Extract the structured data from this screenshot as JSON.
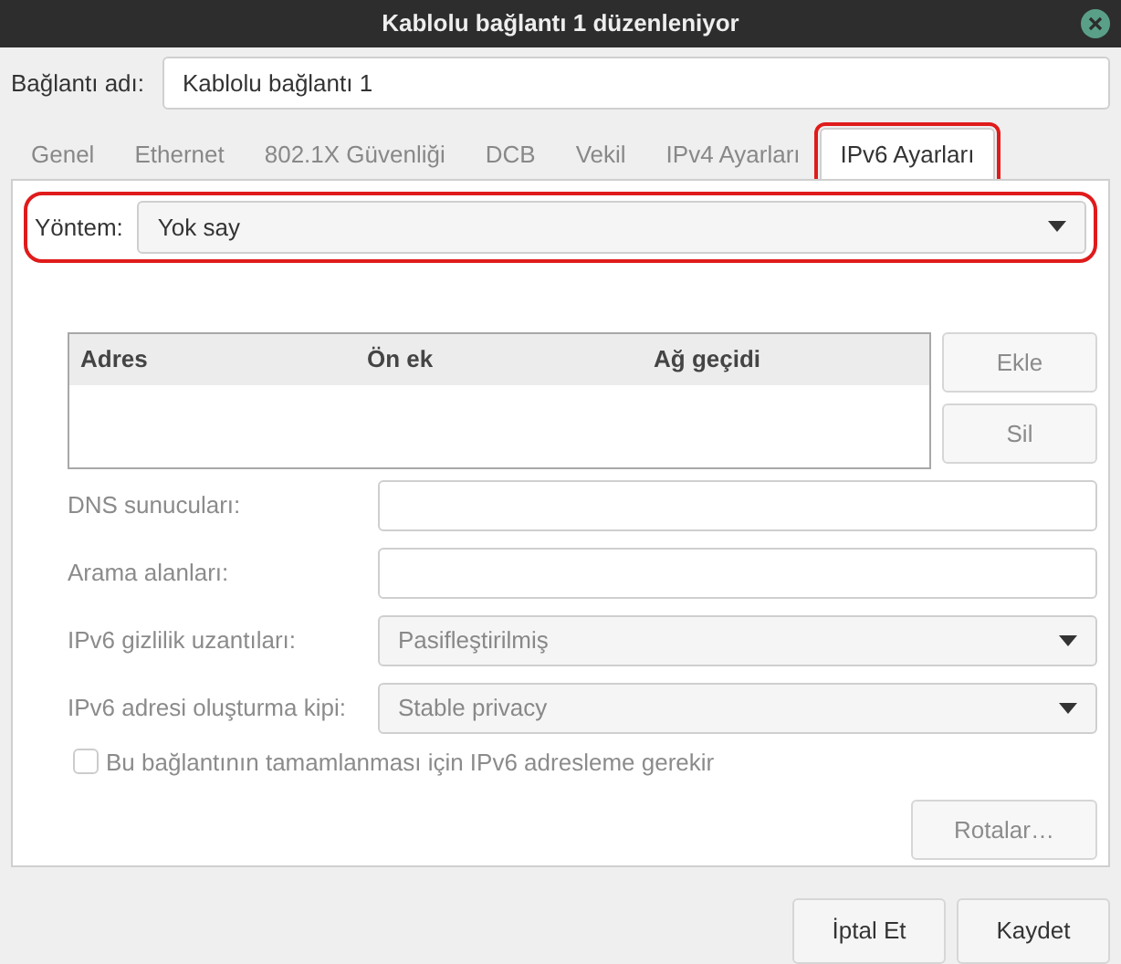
{
  "window": {
    "title": "Kablolu bağlantı 1 düzenleniyor"
  },
  "connection_name": {
    "label": "Bağlantı adı:",
    "value": "Kablolu bağlantı 1"
  },
  "tabs": [
    {
      "label": "Genel",
      "selected": false,
      "highlighted": false
    },
    {
      "label": "Ethernet",
      "selected": false,
      "highlighted": false
    },
    {
      "label": "802.1X Güvenliği",
      "selected": false,
      "highlighted": false
    },
    {
      "label": "DCB",
      "selected": false,
      "highlighted": false
    },
    {
      "label": "Vekil",
      "selected": false,
      "highlighted": false
    },
    {
      "label": "IPv4 Ayarları",
      "selected": false,
      "highlighted": false
    },
    {
      "label": "IPv6 Ayarları",
      "selected": true,
      "highlighted": true
    }
  ],
  "method": {
    "label": "Yöntem:",
    "value": "Yok say",
    "highlighted": true
  },
  "address_table": {
    "columns": [
      "Adres",
      "Ön ek",
      "Ağ geçidi"
    ],
    "buttons": [
      {
        "label": "Ekle",
        "disabled": true
      },
      {
        "label": "Sil",
        "disabled": true
      }
    ]
  },
  "fields": [
    {
      "kind": "text",
      "label": "DNS sunucuları:",
      "disabled": true
    },
    {
      "kind": "text",
      "label": "Arama alanları:",
      "disabled": true
    },
    {
      "kind": "select",
      "label": "IPv6 gizlilik uzantıları:",
      "value": "Pasifleştirilmiş",
      "disabled": true
    },
    {
      "kind": "select",
      "label": "IPv6 adresi oluşturma kipi:",
      "value": "Stable privacy",
      "disabled": true
    }
  ],
  "require_checkbox": {
    "label": "Bu bağlantının tamamlanması için IPv6 adresleme gerekir",
    "checked": false,
    "disabled": true
  },
  "routes_button": {
    "label": "Rotalar…",
    "disabled": true
  },
  "footer_buttons": [
    "İptal Et",
    "Kaydet"
  ]
}
